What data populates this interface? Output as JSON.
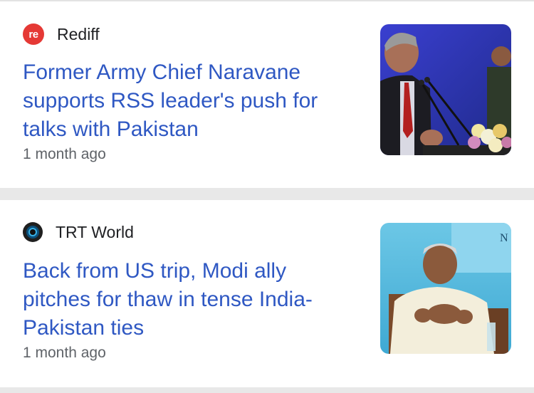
{
  "articles": [
    {
      "source": "Rediff",
      "logo_text": "re",
      "logo_icon": "rediff-logo-icon",
      "headline": "Former Army Chief Naravane supports RSS leader's push for talks with Pakistan",
      "time": "1 month ago",
      "thumbnail": "news-photo-man-speaking-at-podium"
    },
    {
      "source": "TRT World",
      "logo_icon": "trt-world-logo-icon",
      "headline": "Back from US trip, Modi ally pitches for thaw in tense India-Pakistan ties",
      "time": "1 month ago",
      "thumbnail": "news-photo-seated-man",
      "thumbnail_text": "N"
    }
  ],
  "colors": {
    "headline": "#2f58c3",
    "meta": "#5f6368",
    "separator": "#e8e8e8",
    "rediff_red": "#e53935"
  }
}
